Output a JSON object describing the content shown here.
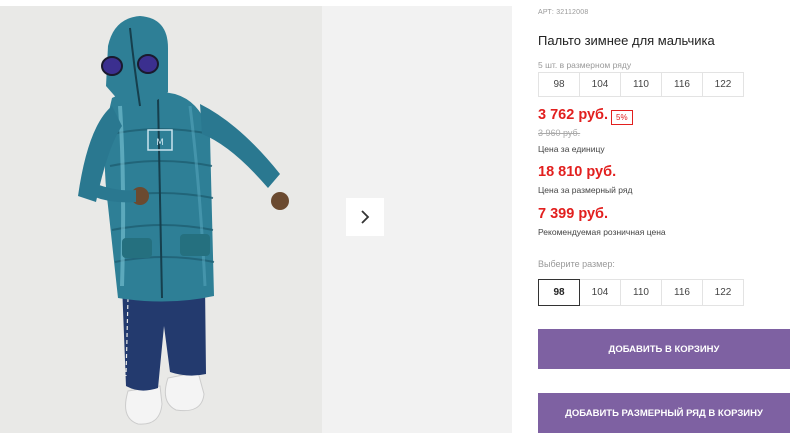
{
  "product": {
    "article": "АРТ: 32112008",
    "title": "Пальто зимнее для мальчика"
  },
  "size_row": {
    "label": "5 шт. в размерном ряду",
    "sizes": [
      "98",
      "104",
      "110",
      "116",
      "122"
    ]
  },
  "prices": {
    "unit_price": "3 762 руб.",
    "discount_badge": "5%",
    "old_price": "3 960 руб.",
    "unit_caption": "Цена за единицу",
    "row_price": "18 810 руб.",
    "row_caption": "Цена за размерный ряд",
    "retail_price": "7 399 руб.",
    "retail_caption": "Рекомендуемая розничная цена"
  },
  "size_picker": {
    "label": "Выберите размер:",
    "sizes": [
      "98",
      "104",
      "110",
      "116",
      "122"
    ],
    "selected": "98"
  },
  "buttons": {
    "add_to_cart": "ДОБАВИТЬ В КОРЗИНУ",
    "add_row_to_cart": "ДОБАВИТЬ РАЗМЕРНЫЙ РЯД В КОРЗИНУ"
  },
  "colors": {
    "accent_red": "#e2201f",
    "button_purple": "#7e61a2",
    "jacket_teal": "#2e7f96",
    "pants_navy": "#233a6e"
  },
  "icons": {
    "next": "chevron-right-icon"
  }
}
